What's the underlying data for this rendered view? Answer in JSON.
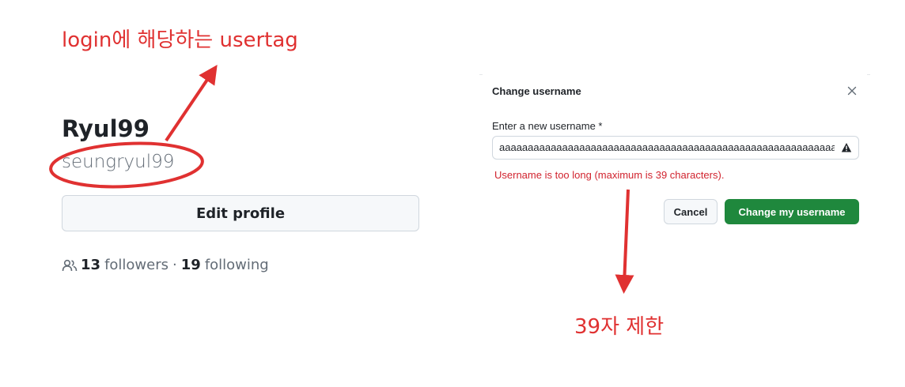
{
  "annotations": {
    "top_note": "login에 해당하는 usertag",
    "bottom_note": "39자 제한",
    "color": "#e03131"
  },
  "profile": {
    "display_name": "Ryul99",
    "login": "seungryul99",
    "edit_button_label": "Edit profile",
    "followers_count": "13",
    "followers_label": "followers",
    "separator": "·",
    "following_count": "19",
    "following_label": "following",
    "people_icon": "people-icon"
  },
  "dialog": {
    "title": "Change username",
    "close_icon": "x-icon",
    "field_label": "Enter a new username *",
    "input_value": "aaaaaaaaaaaaaaaaaaaaaaaaaaaaaaaaaaaaaaaaaaaaaaaaaaaaaaaaaaaaaaaaaaaaaaaaaaaaaaaaa",
    "warning_icon": "alert-icon",
    "error_message": "Username is too long (maximum is 39 characters).",
    "cancel_label": "Cancel",
    "confirm_label": "Change my username",
    "confirm_color": "#1f883d",
    "error_color": "#d1242f"
  }
}
